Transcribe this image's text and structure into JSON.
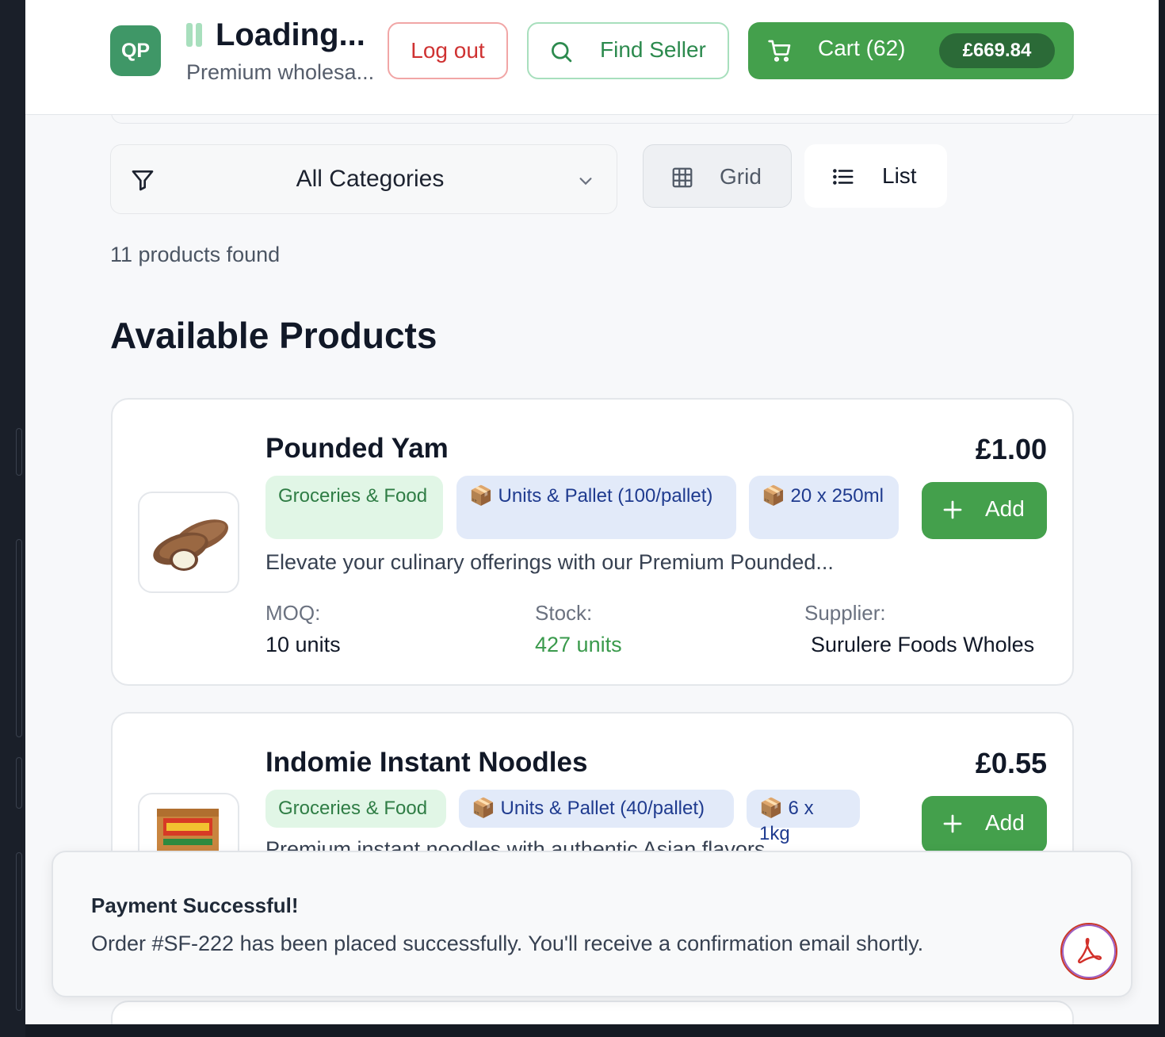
{
  "header": {
    "avatar_initials": "QP",
    "title": "Loading...",
    "subtitle": "Premium wholesa...",
    "logout_label": "Log out",
    "find_seller_label": "Find Seller",
    "cart_label": "Cart (62)",
    "cart_total": "£669.84"
  },
  "filters": {
    "category_selected": "All Categories",
    "view_grid_label": "Grid",
    "view_list_label": "List",
    "active_view": "List"
  },
  "results": {
    "count_text": "11 products found",
    "section_title": "Available Products"
  },
  "products": [
    {
      "name": "Pounded Yam",
      "price": "£1.00",
      "category": "Groceries & Food",
      "pallet": "📦 Units & Pallet (100/pallet)",
      "pack": "📦 20 x 250ml",
      "description": "Elevate your culinary offerings with our Premium Pounded...",
      "moq_label": "MOQ:",
      "moq_value": "10 units",
      "stock_label": "Stock:",
      "stock_value": "427 units",
      "supplier_label": "Supplier:",
      "supplier_value": "Surulere Foods Wholes",
      "add_label": "Add"
    },
    {
      "name": "Indomie Instant Noodles",
      "price": "£0.55",
      "category": "Groceries & Food",
      "pallet": "📦 Units & Pallet (40/pallet)",
      "pack": "📦 6 x 1kg",
      "description": "Premium instant noodles with authentic Asian flavors",
      "add_label": "Add"
    }
  ],
  "toast": {
    "title": "Payment Successful!",
    "message": "Order #SF-222 has been placed successfully. You'll receive a confirmation email shortly."
  },
  "colors": {
    "brand_green": "#44a04c",
    "danger": "#cf3232",
    "avatar": "#3f9767"
  },
  "icons": [
    "pause-icon",
    "search-icon",
    "cart-icon",
    "filter-icon",
    "chevron-down-icon",
    "grid-icon",
    "list-icon",
    "plus-icon",
    "pdf-icon"
  ]
}
